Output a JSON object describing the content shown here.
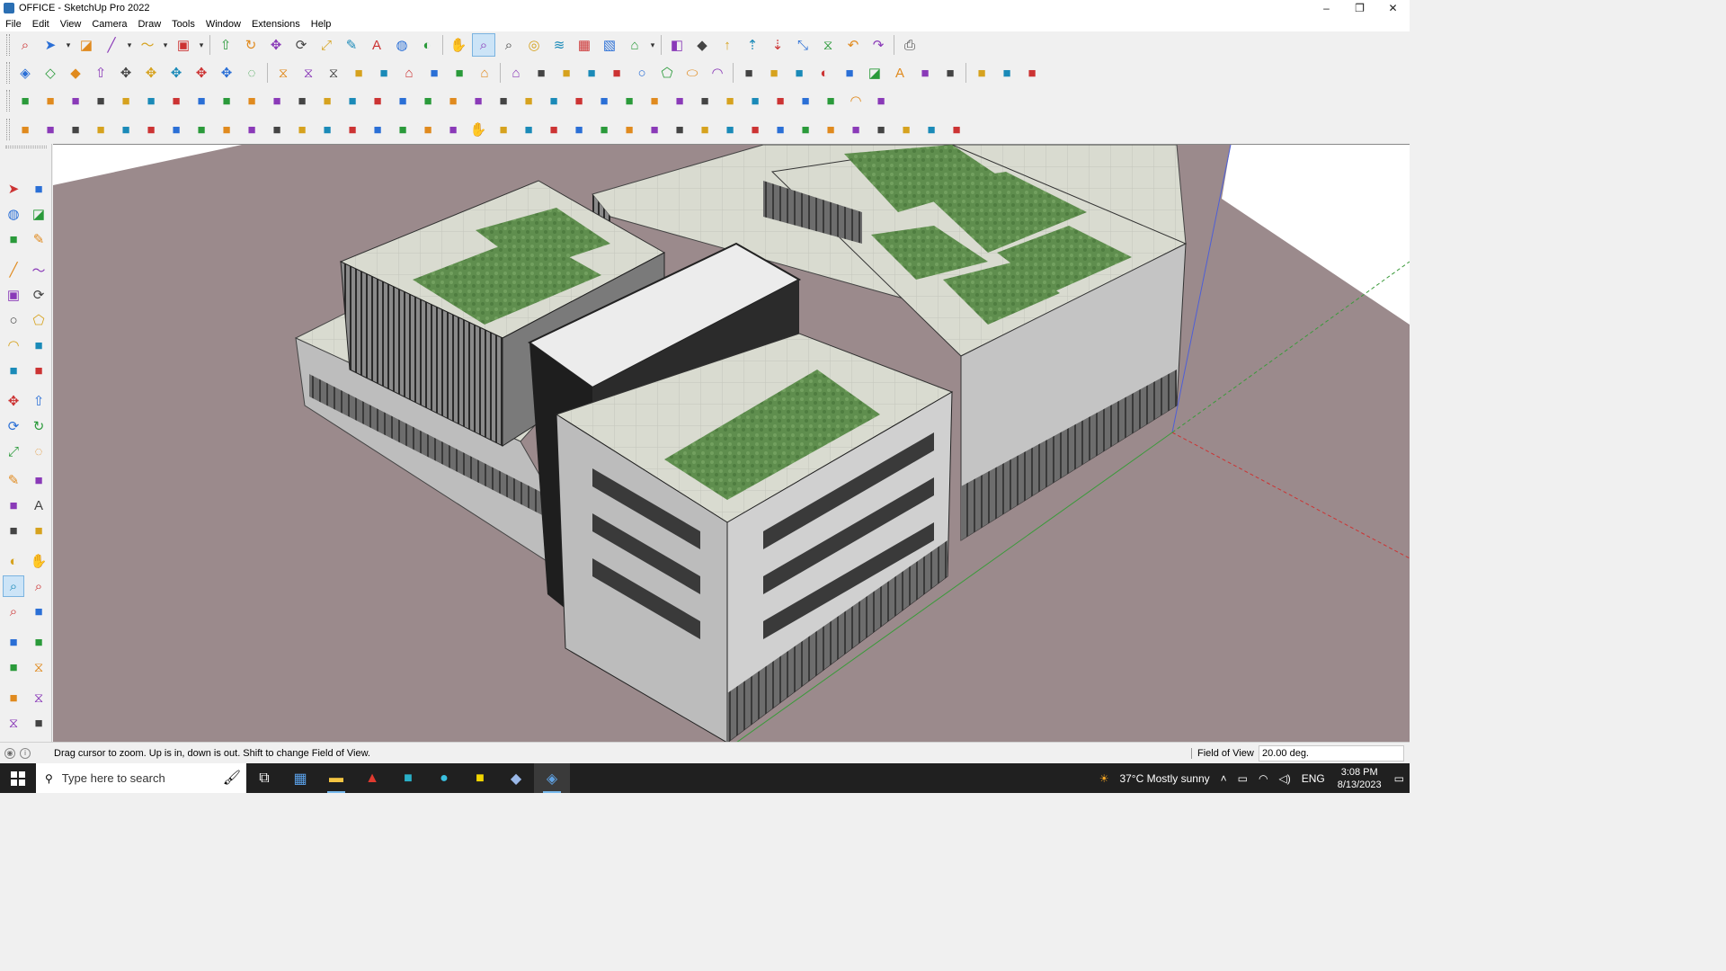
{
  "window": {
    "title": "OFFICE - SketchUp Pro 2022",
    "minimize": "–",
    "restore": "❐",
    "close": "✕"
  },
  "menu": [
    "File",
    "Edit",
    "View",
    "Camera",
    "Draw",
    "Tools",
    "Window",
    "Extensions",
    "Help"
  ],
  "toolbar_rows": [
    [
      "zoom-window-icon",
      "select-icon",
      "dropdown-icon",
      "eraser-icon",
      "line-icon",
      "dropdown-icon",
      "freehand-icon",
      "dropdown-icon",
      "rectangle-icon",
      "dropdown-icon",
      "push-pull-icon",
      "follow-me-icon",
      "move-icon",
      "rotate-icon",
      "scale-icon",
      "tape-icon",
      "text-icon",
      "paint-bucket-icon",
      "orbit-icon",
      "pan-icon",
      "zoom-icon",
      "zoom-extents-icon",
      "xray-icon",
      "hidden-line-icon",
      "shaded-icon",
      "monochrome-icon",
      "warehouse-icon",
      "dropdown-icon",
      "component-icon",
      "extension-icon",
      "solar-north-icon",
      "export-icon",
      "import-icon",
      "scene-icon",
      "section-icon",
      "undo-icon",
      "redo-icon",
      "print-icon"
    ],
    [
      "iso-view-icon",
      "top-view-icon",
      "front-view-icon",
      "push-pull-icon",
      "move-red-icon",
      "move-blue-icon",
      "move-green-icon",
      "move-orange-icon",
      "move-purple-icon",
      "offset-icon",
      "section-plane-icon",
      "section-cut-icon",
      "section-fill-icon",
      "sandbox-icon",
      "stamp-icon",
      "house-icon",
      "building-icon",
      "roof-icon",
      "home-icon",
      "warehouse-2-icon",
      "dynamic-icon",
      "axis-icon",
      "weld-icon",
      "pencil-icon",
      "circle-icon",
      "polygon-icon",
      "ellipse-icon",
      "arc-icon",
      "spline-icon",
      "curve-icon",
      "bezier-icon",
      "orbit-2-icon",
      "lasso-icon",
      "eraser-2-icon",
      "texture-icon",
      "material-icon",
      "camera-icon",
      "bucket-icon",
      "light-icon",
      "render-icon"
    ],
    [
      "plane-blue-icon",
      "plane-blue-2-icon",
      "plane-yellow-icon",
      "plane-green-icon",
      "plane-red-icon",
      "loop-icon",
      "square-red-icon",
      "grid-icon",
      "frame-icon",
      "brick-icon",
      "link-icon",
      "path-icon",
      "cross-red-icon",
      "cross-green-icon",
      "cross-blue-icon",
      "flask-icon",
      "fire-icon",
      "warning-icon",
      "rope-icon",
      "knot-icon",
      "spiral-icon",
      "joint-icon",
      "box-icon",
      "curve-red-icon",
      "stairs-icon",
      "shapes-icon",
      "block-icon",
      "roof-2-icon",
      "fence-icon",
      "window-icon",
      "window-2-icon",
      "window-3-icon",
      "dots-icon",
      "arc-dots-icon",
      "network-icon"
    ],
    [
      "shape-1-icon",
      "wave-icon",
      "car-icon",
      "cut-icon",
      "gear-icon",
      "lattice-icon",
      "snake-icon",
      "cube-icon",
      "ball-icon",
      "roll-icon",
      "wall-icon",
      "wall-2-icon",
      "wall-3-icon",
      "door-icon",
      "column-icon",
      "column-2-icon",
      "beam-icon",
      "hand-icon",
      "panel-icon",
      "arrow-icon",
      "stack-icon",
      "stripe-icon",
      "stripe-2-icon",
      "stripe-3-icon",
      "stripe-4-icon",
      "chip-icon",
      "pattern-icon",
      "wall-4-icon",
      "wall-5-icon",
      "grid-2-icon",
      "grid-3-icon",
      "comb-icon",
      "leaf-icon",
      "swirl-icon",
      "star-icon",
      "ribbon-icon",
      "tower-icon",
      "diamond-icon"
    ]
  ],
  "left_tools": [
    [
      "select-arrow-icon",
      "make-component-icon"
    ],
    [
      "paint-bucket-icon",
      "eraser-icon"
    ],
    [
      "tag-icon",
      "tape-measure-icon"
    ],
    [
      "line-icon",
      "freehand-icon"
    ],
    [
      "rectangle-icon",
      "rotated-rectangle-icon"
    ],
    [
      "circle-icon",
      "polygon-icon"
    ],
    [
      "arc-icon",
      "two-point-arc-icon"
    ],
    [
      "three-point-arc-icon",
      "pie-icon"
    ],
    [
      "move-icon",
      "push-pull-icon"
    ],
    [
      "rotate-icon",
      "follow-me-icon"
    ],
    [
      "scale-icon",
      "offset-icon"
    ],
    [
      "tape-icon",
      "dimension-icon"
    ],
    [
      "protractor-icon",
      "text-icon"
    ],
    [
      "axes-icon",
      "3d-text-icon"
    ],
    [
      "orbit-icon",
      "pan-icon"
    ],
    [
      "zoom-icon",
      "zoom-window-icon"
    ],
    [
      "zoom-extents-icon",
      "previous-view-icon"
    ],
    [
      "position-camera-icon",
      "look-around-icon"
    ],
    [
      "walk-icon",
      "section-plane-icon"
    ],
    [
      "display-sections-icon",
      "section-cuts-icon"
    ],
    [
      "section-fill-icon",
      "outliner-icon"
    ]
  ],
  "status": {
    "message": "Drag cursor to zoom.  Up is in, down is out. Shift to change Field of View.",
    "vcb_label": "Field of View",
    "vcb_value": "20.00 deg."
  },
  "taskbar": {
    "search_placeholder": "Type here to search",
    "apps": [
      "task-view-icon",
      "calculator-icon",
      "file-explorer-icon",
      "acrobat-icon",
      "app-3-icon",
      "edge-icon",
      "sticky-notes-icon",
      "sketchup-layout-icon",
      "sketchup-icon"
    ],
    "weather": "37°C  Mostly sunny",
    "lang": "ENG",
    "time": "3:08 PM",
    "date": "8/13/2023"
  },
  "colors": {
    "ground": "#9b8a8c",
    "green_roof": "#5f8e4e",
    "accent": "#cce4f7"
  }
}
